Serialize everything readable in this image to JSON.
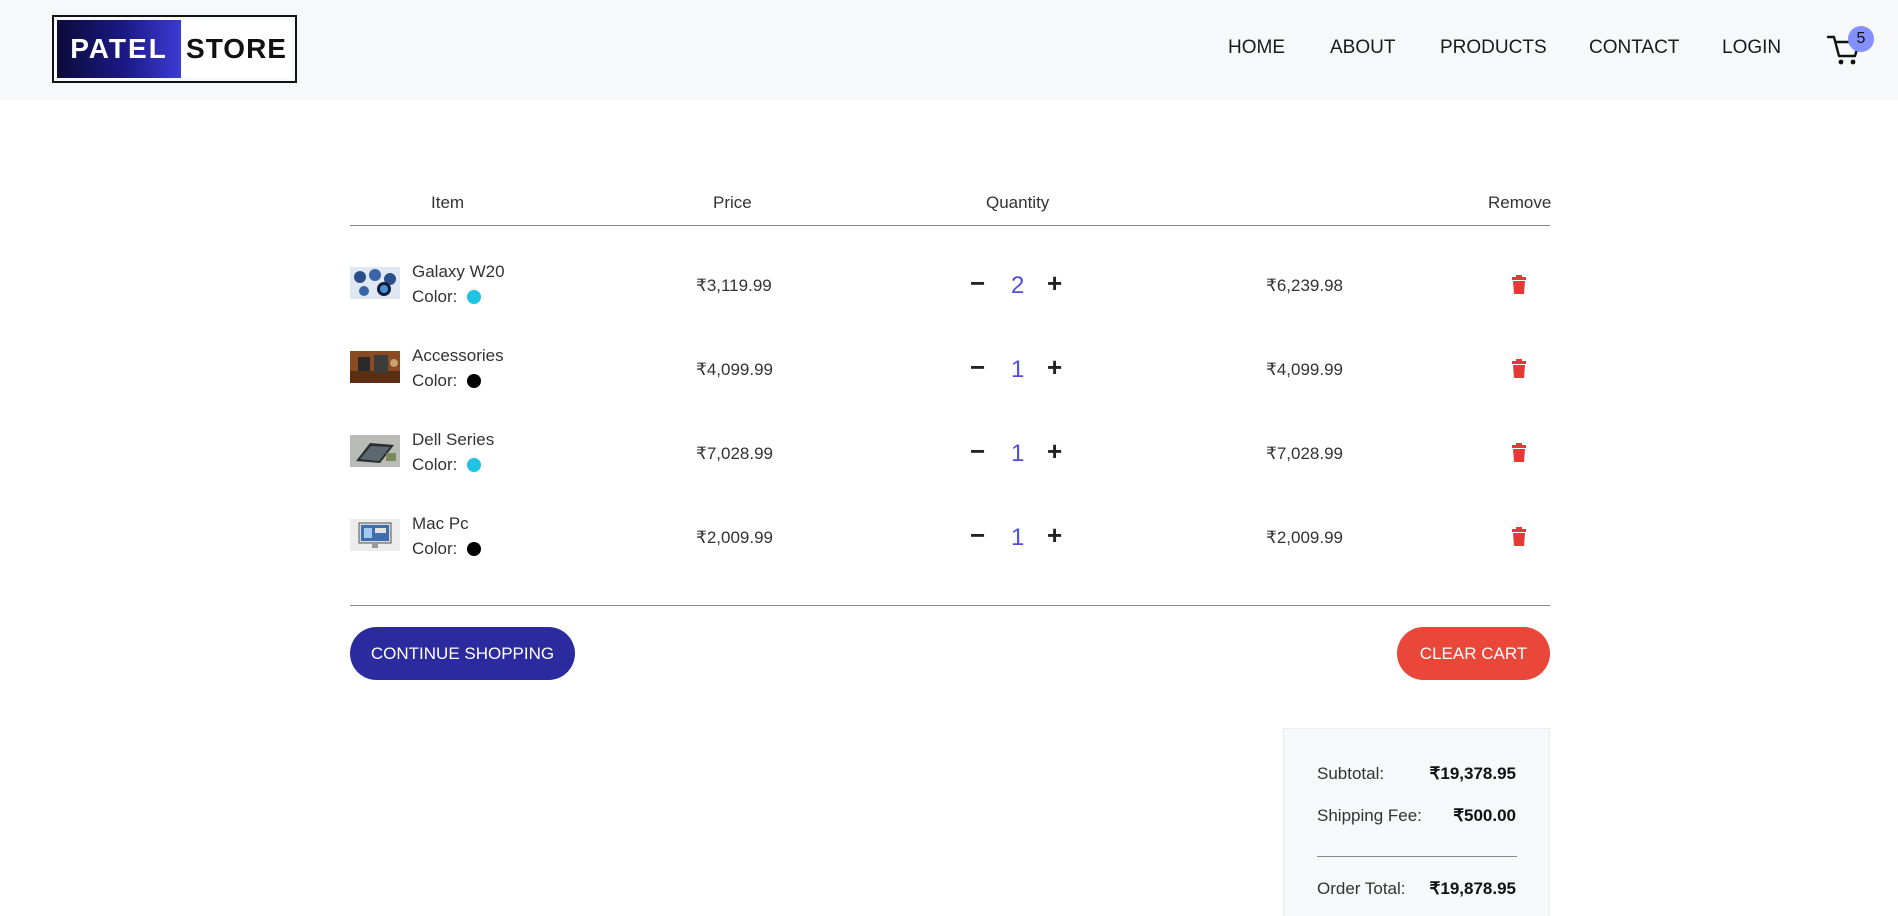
{
  "brand": {
    "left": "PATEL",
    "right": "STORE"
  },
  "nav": {
    "home": "HOME",
    "about": "ABOUT",
    "products": "PRODUCTS",
    "contact": "CONTACT",
    "login": "LOGIN"
  },
  "cart": {
    "count": "5",
    "icon": "cart-icon"
  },
  "table": {
    "headers": {
      "item": "Item",
      "price": "Price",
      "quantity": "Quantity",
      "remove": "Remove"
    },
    "color_label": "Color:",
    "minus_symbol": "−",
    "plus_symbol": "+",
    "items": [
      {
        "name": "Galaxy W20",
        "color": "#1ec3e6",
        "price": "₹3,119.99",
        "quantity": "2",
        "subtotal": "₹6,239.98"
      },
      {
        "name": "Accessories",
        "color": "#000000",
        "price": "₹4,099.99",
        "quantity": "1",
        "subtotal": "₹4,099.99"
      },
      {
        "name": "Dell Series",
        "color": "#1ec3e6",
        "price": "₹7,028.99",
        "quantity": "1",
        "subtotal": "₹7,028.99"
      },
      {
        "name": "Mac Pc",
        "color": "#000000",
        "price": "₹2,009.99",
        "quantity": "1",
        "subtotal": "₹2,009.99"
      }
    ]
  },
  "buttons": {
    "continue": "CONTINUE SHOPPING",
    "clear": "CLEAR CART"
  },
  "summary": {
    "subtotal_label": "Subtotal:",
    "subtotal_value": "₹19,378.95",
    "shipping_label": "Shipping Fee:",
    "shipping_value": "₹500.00",
    "total_label": "Order Total:",
    "total_value": "₹19,878.95"
  },
  "colors": {
    "primary": "#2b2a9e",
    "danger": "#e8473a",
    "qty": "#4f4fd8",
    "badge": "#8490ff"
  }
}
